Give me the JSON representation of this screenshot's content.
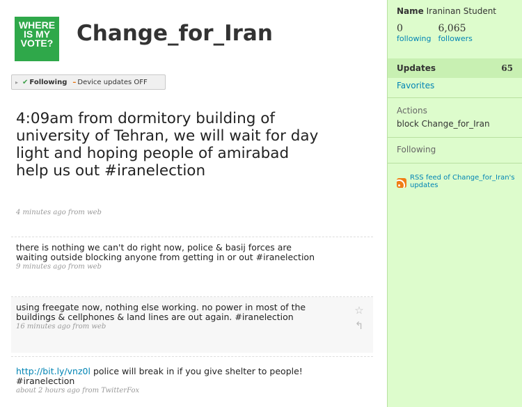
{
  "profile": {
    "avatar_lines": [
      "WHERE",
      "IS MY",
      "VOTE?"
    ],
    "screen_name": "Change_for_Iran"
  },
  "follow_bar": {
    "arrow": "▸",
    "check": "✔",
    "following_label": "Following",
    "dash": "–",
    "device_label": "Device updates OFF"
  },
  "latest_status": {
    "text": "4:09am from dormitory building of university of Tehran, we will wait for day light and hoping people of amirabad help us out #iranelection",
    "meta": "4 minutes ago from web"
  },
  "timeline": [
    {
      "text": "there is nothing we can't do right now, police & basij forces are waiting outside blocking anyone from getting in or out #iranelection",
      "meta": "9 minutes ago from web"
    },
    {
      "text": "using freegate now, nothing else working. no power in most of the buildings & cellphones & land lines are out again. #iranelection",
      "meta": "16 minutes ago from web"
    },
    {
      "link": "http://bit.ly/vnz0l",
      "text": " police will break in if you give shelter to people! #iranelection",
      "meta": "about 2 hours ago from TwitterFox"
    }
  ],
  "status_actions": {
    "favorite_icon": "☆",
    "reply_icon": "↰"
  },
  "sidebar": {
    "name_label": "Name",
    "name_value": "Iraninan Student",
    "following_count": "0",
    "following_label": "following",
    "followers_count": "6,065",
    "followers_label": "followers",
    "updates_label": "Updates",
    "updates_count": "65",
    "favorites_label": "Favorites",
    "actions_label": "Actions",
    "block_label": "block",
    "block_target": "Change_for_Iran",
    "following_section_label": "Following",
    "rss_label": "RSS feed of Change_for_Iran's updates"
  },
  "colors": {
    "link": "#0084b4",
    "sidebar_bg": "#ddfccc",
    "sidebar_active": "#c8f0b2",
    "avatar_green": "#2fa84a"
  }
}
